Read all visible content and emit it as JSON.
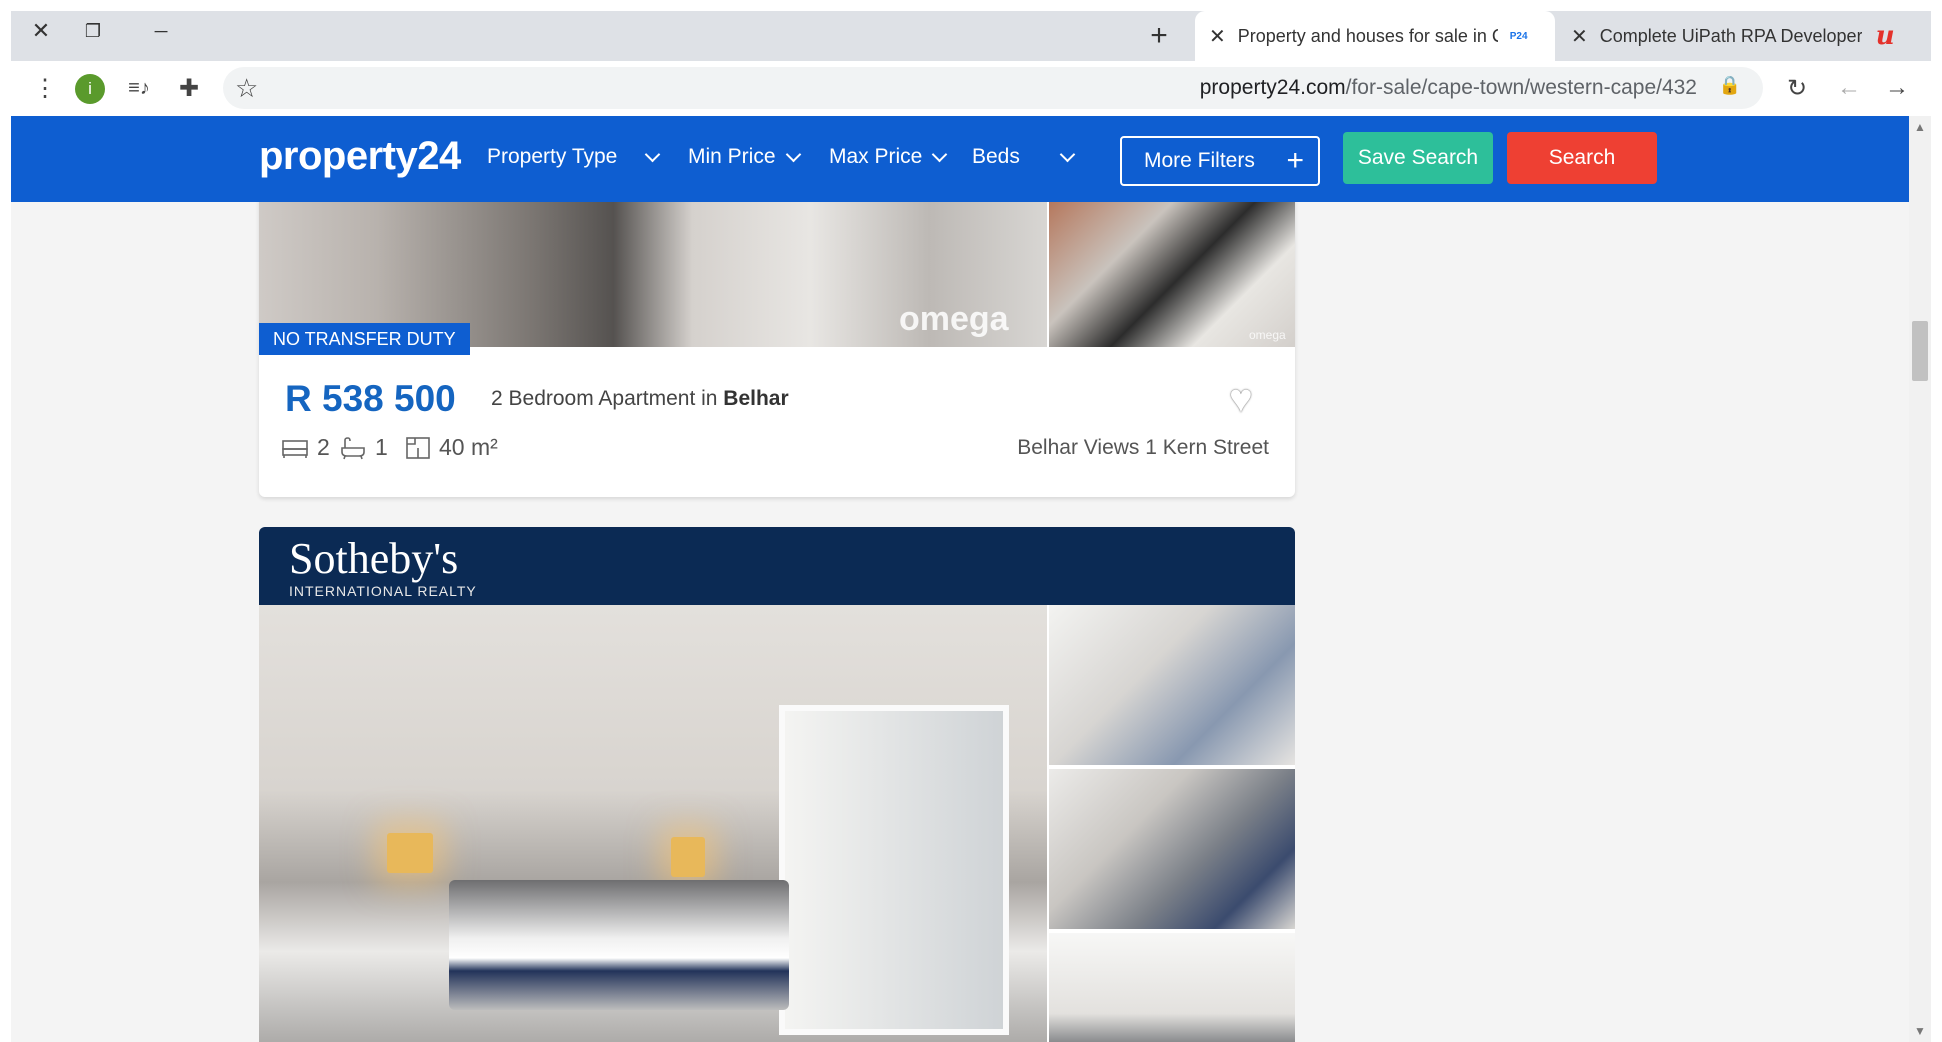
{
  "browser": {
    "window_controls": {
      "close": "✕",
      "restore": "❐",
      "minimize": "─"
    },
    "new_tab": "+",
    "tabs": [
      {
        "title": "Property and houses for sale in C",
        "favicon": "P24",
        "close": "✕",
        "active": true
      },
      {
        "title": "Complete UiPath RPA Developer",
        "favicon": "u",
        "close": "✕",
        "active": false
      }
    ],
    "toolbar": {
      "menu_icon": "⋮",
      "profile_initial": "i",
      "media_icon": "≡♪",
      "extensions_icon": "✚",
      "bookmark_icon": "☆",
      "url_domain": "property24.com",
      "url_path": "/for-sale/cape-town/western-cape/432",
      "lock_icon": "🔒",
      "reload_icon": "↻",
      "back_icon": "←",
      "forward_icon": "→"
    }
  },
  "site": {
    "logo": "property24",
    "nav": [
      {
        "label": "Property Type"
      },
      {
        "label": "Min Price"
      },
      {
        "label": "Max Price"
      },
      {
        "label": "Beds"
      }
    ],
    "more_filters": "More Filters",
    "more_filters_plus": "+",
    "save_search": "Save Search",
    "search": "Search",
    "colors": {
      "header": "#0e5ed1",
      "save": "#2dbf9a",
      "search": "#ee4033",
      "price": "#1565c0"
    }
  },
  "listings": [
    {
      "badge": "NO TRANSFER DUTY",
      "watermark": "omega",
      "watermark_small": "omega",
      "price": "R 538 500",
      "desc_prefix": "2 Bedroom Apartment in ",
      "suburb": "Belhar",
      "beds": "2",
      "baths": "1",
      "size": "40 m²",
      "address": "Belhar Views 1 Kern Street",
      "favourite_icon": "♥"
    },
    {
      "agency": "Sotheby's",
      "agency_sub": "INTERNATIONAL REALTY"
    }
  ]
}
